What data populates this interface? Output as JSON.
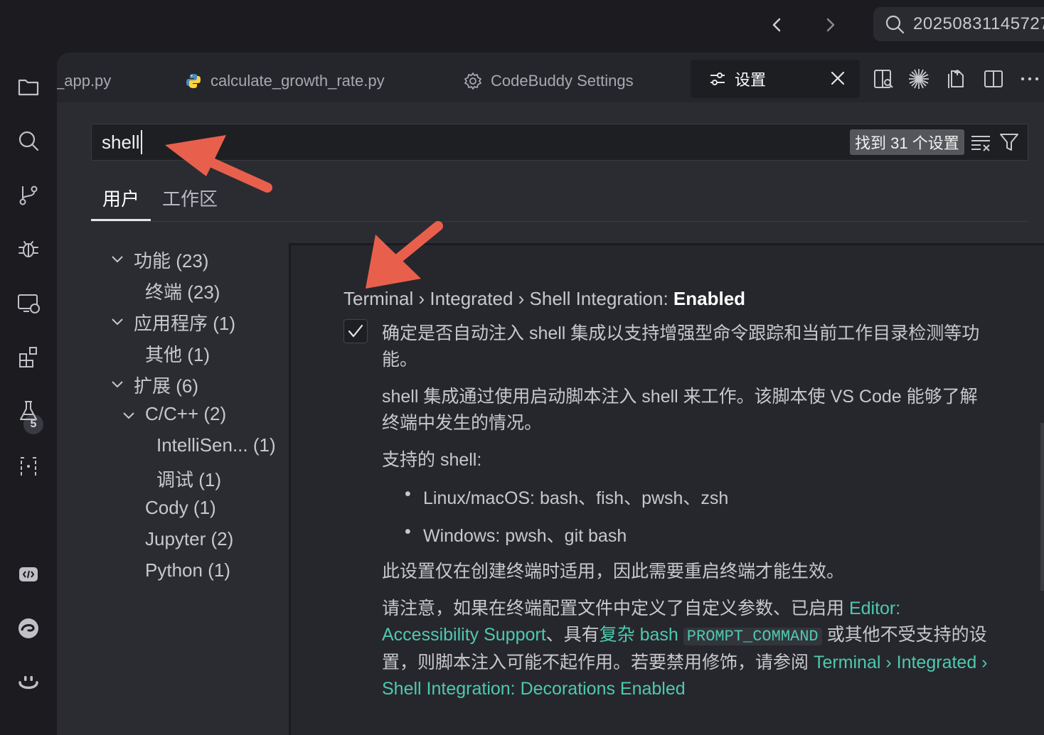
{
  "titlebar": {
    "back_icon": "chevron-left-icon",
    "forward_icon": "chevron-right-icon",
    "search_text": "20250831145727"
  },
  "activity_bar": {
    "items": [
      "explorer-icon",
      "search-icon",
      "source-control-icon",
      "debug-icon",
      "remote-explorer-icon",
      "extensions-icon",
      "testing-icon",
      "remote-braces-icon"
    ],
    "extensions_badge": "5",
    "bottom_items": [
      "codebuddy-icon",
      "edge-icon",
      "copilot-icon"
    ]
  },
  "tabs": [
    {
      "label": "_app.py"
    },
    {
      "label": "calculate_growth_rate.py"
    },
    {
      "label": "CodeBuddy Settings"
    },
    {
      "label": "设置",
      "active": true
    }
  ],
  "search": {
    "value": "shell",
    "result_count": "找到 31 个设置"
  },
  "scopes": {
    "user": "用户",
    "workspace": "工作区"
  },
  "toc": [
    {
      "label": "功能 (23)"
    },
    {
      "label": "终端 (23)"
    },
    {
      "label": "应用程序 (1)"
    },
    {
      "label": "其他 (1)"
    },
    {
      "label": "扩展 (6)"
    },
    {
      "label": "C/C++ (2)"
    },
    {
      "label": "IntelliSen... (1)"
    },
    {
      "label": "调试 (1)"
    },
    {
      "label": "Cody (1)"
    },
    {
      "label": "Jupyter (2)"
    },
    {
      "label": "Python (1)"
    }
  ],
  "setting": {
    "category": "Terminal › Integrated › Shell Integration: ",
    "name": "Enabled",
    "checked": true,
    "desc1": "确定是否自动注入 shell 集成以支持增强型命令跟踪和当前工作目录检测等功能。",
    "desc2": "shell 集成通过使用启动脚本注入 shell 来工作。该脚本使 VS Code 能够了解终端中发生的情况。",
    "supported_label": "支持的 shell:",
    "bullets": [
      "Linux/macOS: bash、fish、pwsh、zsh",
      "Windows: pwsh、git bash"
    ],
    "desc3": "此设置仅在创建终端时适用，因此需要重启终端才能生效。",
    "note_prefix": "请注意，如果在终端配置文件中定义了自定义参数、已启用 ",
    "note_link1": "Editor: Accessibility Support",
    "note_mid1": "、具有",
    "note_link2": "复杂 bash",
    "note_code": "PROMPT_COMMAND",
    "note_mid2": " 或其他不受支持的设置，则脚本注入可能不起作用。若要禁用修饰，请参阅 ",
    "note_link3": "Terminal › Integrated › Shell Integration: Decorations Enabled"
  },
  "colors": {
    "link": "#4ec9b0",
    "annotation_arrow": "#e8604c"
  }
}
